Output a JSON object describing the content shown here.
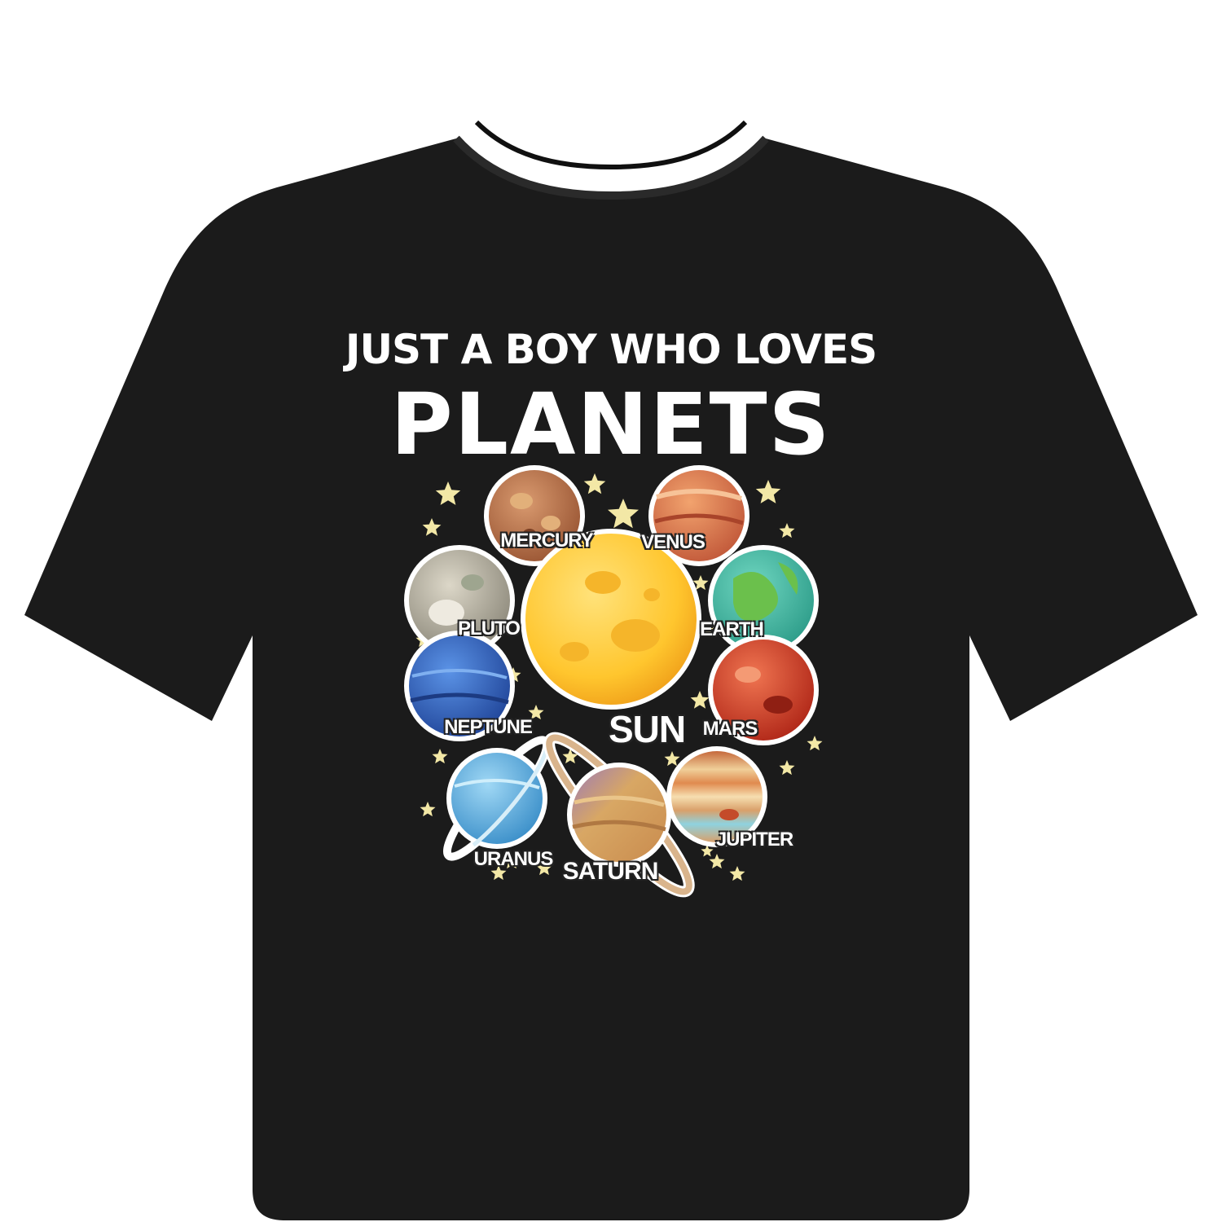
{
  "product": {
    "garment": "T-shirt",
    "garment_color": "#1a1a1a"
  },
  "print": {
    "headline_small": "JUST A BOY WHO LOVES",
    "headline_big": "PLANETS",
    "text_color": "#ffffff",
    "star_color": "#f3e8a6"
  },
  "bodies": [
    {
      "id": "mercury",
      "label": "MERCURY",
      "icon": "mercury-planet-icon",
      "colors": [
        "#c7805a",
        "#9a5634"
      ]
    },
    {
      "id": "venus",
      "label": "VENUS",
      "icon": "venus-planet-icon",
      "colors": [
        "#e98e58",
        "#c2593a"
      ]
    },
    {
      "id": "pluto",
      "label": "PLUTO",
      "icon": "pluto-planet-icon",
      "colors": [
        "#c9c4b6",
        "#8e8a7c"
      ]
    },
    {
      "id": "earth",
      "label": "EARTH",
      "icon": "earth-planet-icon",
      "colors": [
        "#4fc2a6",
        "#6bc04c"
      ]
    },
    {
      "id": "sun",
      "label": "SUN",
      "icon": "sun-icon",
      "colors": [
        "#ffd13b",
        "#f0a81e"
      ]
    },
    {
      "id": "neptune",
      "label": "NEPTUNE",
      "icon": "neptune-planet-icon",
      "colors": [
        "#3f78d6",
        "#21469a"
      ]
    },
    {
      "id": "mars",
      "label": "MARS",
      "icon": "mars-planet-icon",
      "colors": [
        "#e45a3a",
        "#b52c1d"
      ]
    },
    {
      "id": "uranus",
      "label": "URANUS",
      "icon": "uranus-planet-icon",
      "colors": [
        "#7fc4ea",
        "#3b8fc9"
      ]
    },
    {
      "id": "saturn",
      "label": "SATURN",
      "icon": "saturn-planet-icon",
      "colors": [
        "#d8a764",
        "#9d7bb6"
      ]
    },
    {
      "id": "jupiter",
      "label": "JUPITER",
      "icon": "jupiter-planet-icon",
      "colors": [
        "#e8b67d",
        "#c5683b"
      ]
    }
  ]
}
